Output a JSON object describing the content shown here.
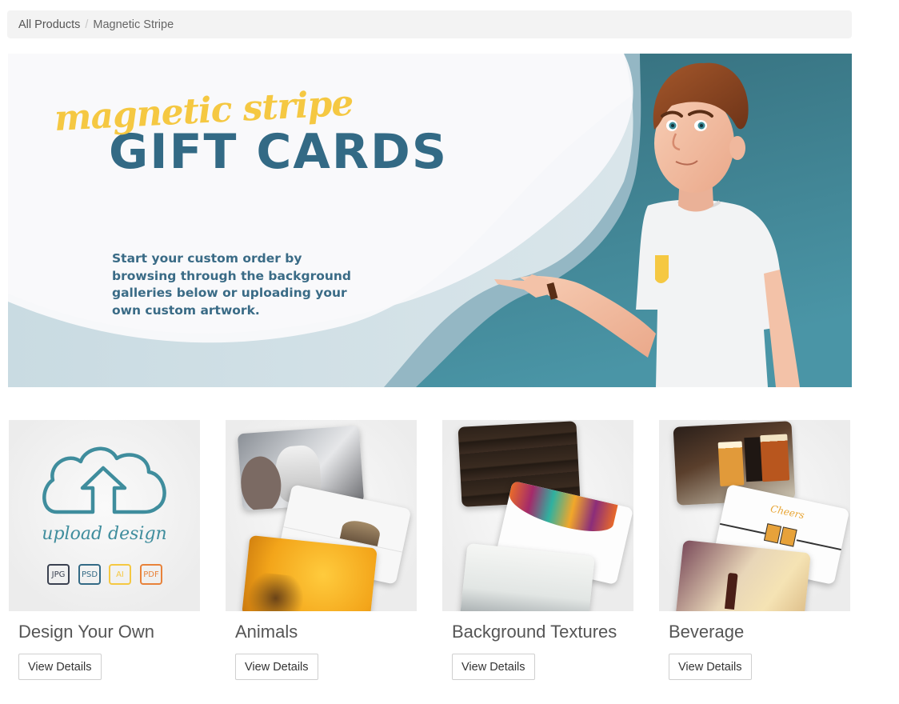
{
  "breadcrumb": {
    "items": [
      {
        "label": "All Products"
      },
      {
        "label": "Magnetic Stripe"
      }
    ],
    "separator": "/"
  },
  "banner": {
    "script_title": "magnetic stripe",
    "main_title": "GIFT CARDS",
    "tagline": "Start your custom order by browsing through the background galleries below or uploading your own custom artwork.",
    "colors": {
      "teal": "#3f8597",
      "navy_text": "#336a85",
      "yellow": "#f5c842"
    }
  },
  "products": [
    {
      "title": "Design Your Own",
      "button": "View Details",
      "thumbnail": {
        "icon": "cloud-upload-icon",
        "caption": "upload design",
        "formats": [
          {
            "label": "JPG",
            "color": "#3a4150"
          },
          {
            "label": "PSD",
            "color": "#336a85"
          },
          {
            "label": "AI",
            "color": "#f5c842"
          },
          {
            "label": "PDF",
            "color": "#e8823a"
          }
        ]
      }
    },
    {
      "title": "Animals",
      "button": "View Details",
      "thumbnail": {
        "cards": [
          "husky-and-woman",
          "peeking-cat",
          "honeycomb-bees"
        ]
      }
    },
    {
      "title": "Background Textures",
      "button": "View Details",
      "thumbnail": {
        "cards": [
          "dark-wood",
          "colorful-swirls",
          "misty-mountains"
        ]
      }
    },
    {
      "title": "Beverage",
      "button": "View Details",
      "thumbnail": {
        "cards": [
          "beer-glasses",
          "cheers-mugs",
          "wine-picnic"
        ],
        "card_text": "Cheers"
      }
    }
  ]
}
